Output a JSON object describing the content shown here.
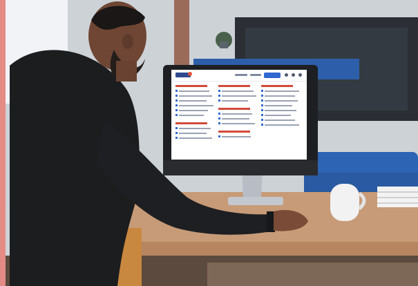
{
  "image": {
    "description_tags": [
      "office-desk",
      "man-at-computer",
      "desktop-monitor",
      "website-on-screen"
    ],
    "colors": {
      "wall": "#cdd2d7",
      "desk": "#c79b78",
      "shirt": "#1c1d1f",
      "skin": "#7a4b36",
      "monitor_frame": "#1e1f22",
      "screen_bg": "#ffffff",
      "accent_blue": "#2f66d0",
      "accent_red": "#d24a3a",
      "sofa_blue": "#2e64b4"
    },
    "screen": {
      "columns": 3
    }
  }
}
